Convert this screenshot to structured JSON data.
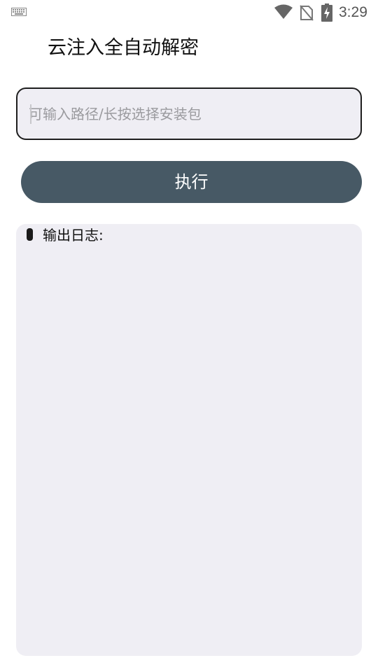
{
  "status_bar": {
    "time": "3:29",
    "icons": [
      "keyboard-icon",
      "wifi-icon",
      "no-sim-icon",
      "battery-charging-icon"
    ]
  },
  "header": {
    "title": "云注入全自动解密"
  },
  "path_input": {
    "value": "",
    "placeholder": "可输入路径/长按选择安装包"
  },
  "execute_button": {
    "label": "执行"
  },
  "log": {
    "label": "输出日志:"
  },
  "colors": {
    "button_bg": "#475965",
    "panel_bg": "#efeef4",
    "input_border": "#1e1e1e"
  }
}
